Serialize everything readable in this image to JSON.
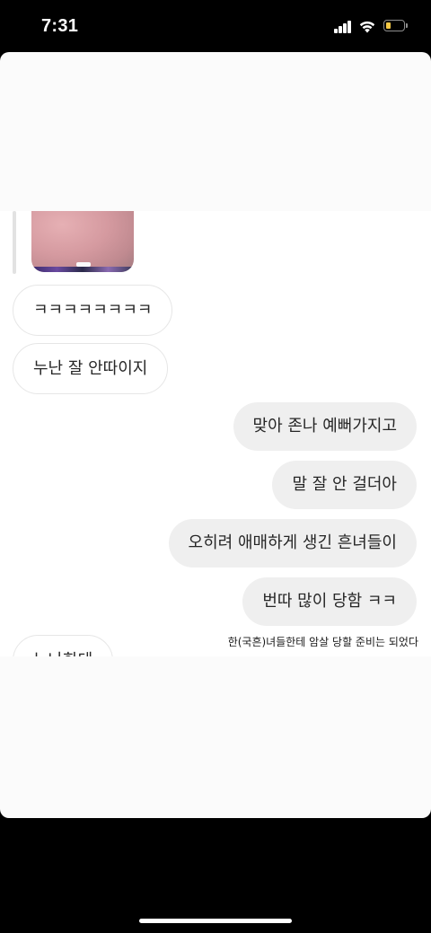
{
  "status_bar": {
    "time": "7:31",
    "signal_icon": "cellular-signal-icon",
    "wifi_icon": "wifi-icon",
    "battery_icon": "battery-low-icon",
    "battery_color": "#f6c945"
  },
  "chat": {
    "photo_icon": "shared-photo-thumbnail",
    "messages": [
      {
        "side": "incoming",
        "text": "ㅋㅋㅋㅋㅋㅋㅋㅋ"
      },
      {
        "side": "incoming",
        "text": "누난 잘 안따이지"
      },
      {
        "side": "outgoing",
        "text": "맞아 존나 예뻐가지고"
      },
      {
        "side": "outgoing",
        "text": "말 잘 안 걸더아"
      },
      {
        "side": "outgoing",
        "text": "오히려 애매하게 생긴 흔녀들이"
      },
      {
        "side": "outgoing",
        "text": "번따 많이 당함 ㅋㅋ"
      },
      {
        "side": "incoming",
        "text": "누나한테"
      }
    ],
    "caption": "한(국흔)녀들한테 암살 당할 준비는 되었다"
  },
  "colors": {
    "incoming_bubble_border": "#e6e6e6",
    "outgoing_bubble_bg": "#efefef",
    "text": "#262626"
  }
}
